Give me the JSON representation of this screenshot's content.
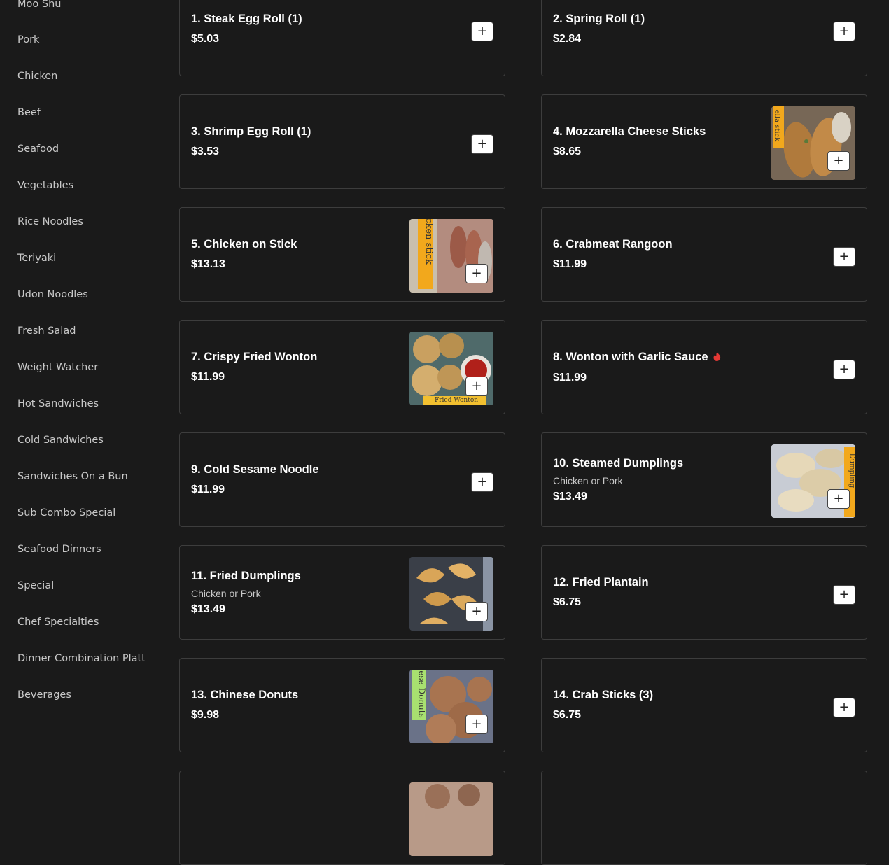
{
  "sidebar": {
    "categories": [
      "Moo Shu",
      "Pork",
      "Chicken",
      "Beef",
      "Seafood",
      "Vegetables",
      "Rice Noodles",
      "Teriyaki",
      "Udon Noodles",
      "Fresh Salad",
      "Weight Watcher",
      "Hot Sandwiches",
      "Cold Sandwiches",
      "Sandwiches On a Bun",
      "Sub Combo Special",
      "Seafood Dinners",
      "Special",
      "Chef Specialties",
      "Dinner Combination Platter",
      "Beverages"
    ]
  },
  "menu": {
    "add_symbol": "+",
    "items": [
      {
        "name": "1. Steak Egg Roll (1)",
        "price": "$5.03"
      },
      {
        "name": "2. Spring Roll (1)",
        "price": "$2.84"
      },
      {
        "name": "3. Shrimp Egg Roll (1)",
        "price": "$3.53"
      },
      {
        "name": "4. Mozzarella Cheese Sticks",
        "price": "$8.65",
        "image": "mozzarella-sticks-photo",
        "photo_label": "ella stick"
      },
      {
        "name": "5. Chicken on Stick",
        "price": "$13.13",
        "image": "chicken-on-stick-photo",
        "photo_label": "icken stick"
      },
      {
        "name": "6. Crabmeat Rangoon",
        "price": "$11.99"
      },
      {
        "name": "7. Crispy Fried Wonton",
        "price": "$11.99",
        "image": "fried-wonton-photo",
        "photo_label": "Fried Wonton"
      },
      {
        "name": "8. Wonton with Garlic Sauce",
        "price": "$11.99",
        "spicy": true,
        "spicy_color": "#e53935"
      },
      {
        "name": "9. Cold Sesame Noodle",
        "price": "$11.99"
      },
      {
        "name": "10. Steamed Dumplings",
        "description": "Chicken or Pork",
        "price": "$13.49",
        "image": "steamed-dumplings-photo",
        "photo_label": "Dumpling"
      },
      {
        "name": "11. Fried Dumplings",
        "description": "Chicken or Pork",
        "price": "$13.49",
        "image": "fried-dumplings-photo"
      },
      {
        "name": "12. Fried Plantain",
        "price": "$6.75"
      },
      {
        "name": "13. Chinese Donuts",
        "price": "$9.98",
        "image": "chinese-donuts-photo",
        "photo_label": "ese Donuts"
      },
      {
        "name": "14. Crab Sticks (3)",
        "price": "$6.75"
      }
    ]
  },
  "colors": {
    "background": "#1a1a1a",
    "card_border": "#3d3d3d",
    "text": "#ffffff",
    "muted_text": "#c8c8c8"
  }
}
